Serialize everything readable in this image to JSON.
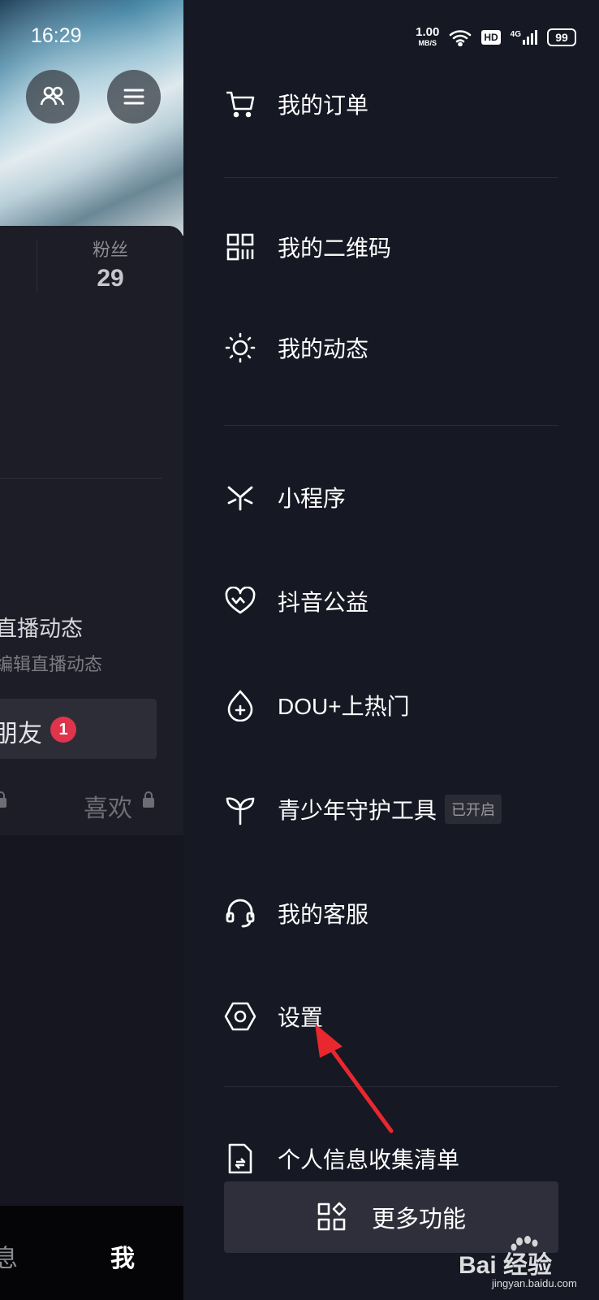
{
  "status_bar": {
    "time": "16:29",
    "speed_value": "1.00",
    "speed_unit": "MB/S",
    "hd": "HD",
    "network": "4G",
    "battery": "99"
  },
  "profile_bg": {
    "stat_label": "粉丝",
    "stat_value": "29",
    "live_title": "直播动态",
    "live_sub": "编辑直播动态",
    "friend_label": "朋友",
    "friend_badge": "1",
    "likes_tab": "喜欢",
    "nav_msg": "息",
    "nav_me": "我"
  },
  "menu": {
    "items": [
      {
        "label": "我的订单",
        "icon": "cart-icon"
      },
      {
        "label": "我的二维码",
        "icon": "qr-code-icon"
      },
      {
        "label": "我的动态",
        "icon": "sun-icon"
      },
      {
        "label": "小程序",
        "icon": "mini-program-icon"
      },
      {
        "label": "抖音公益",
        "icon": "heart-icon"
      },
      {
        "label": "DOU+上热门",
        "icon": "flame-plus-icon"
      },
      {
        "label": "青少年守护工具",
        "icon": "sprout-icon",
        "tag": "已开启"
      },
      {
        "label": "我的客服",
        "icon": "headset-icon"
      },
      {
        "label": "设置",
        "icon": "settings-hex-icon"
      },
      {
        "label": "个人信息收集清单",
        "icon": "document-icon"
      }
    ],
    "more_label": "更多功能"
  },
  "watermark": {
    "text": "Bai 经验",
    "url": "jingyan.baidu.com"
  },
  "colors": {
    "background": "#161823",
    "annotation_arrow": "#e8282e",
    "badge": "#e0334c"
  }
}
